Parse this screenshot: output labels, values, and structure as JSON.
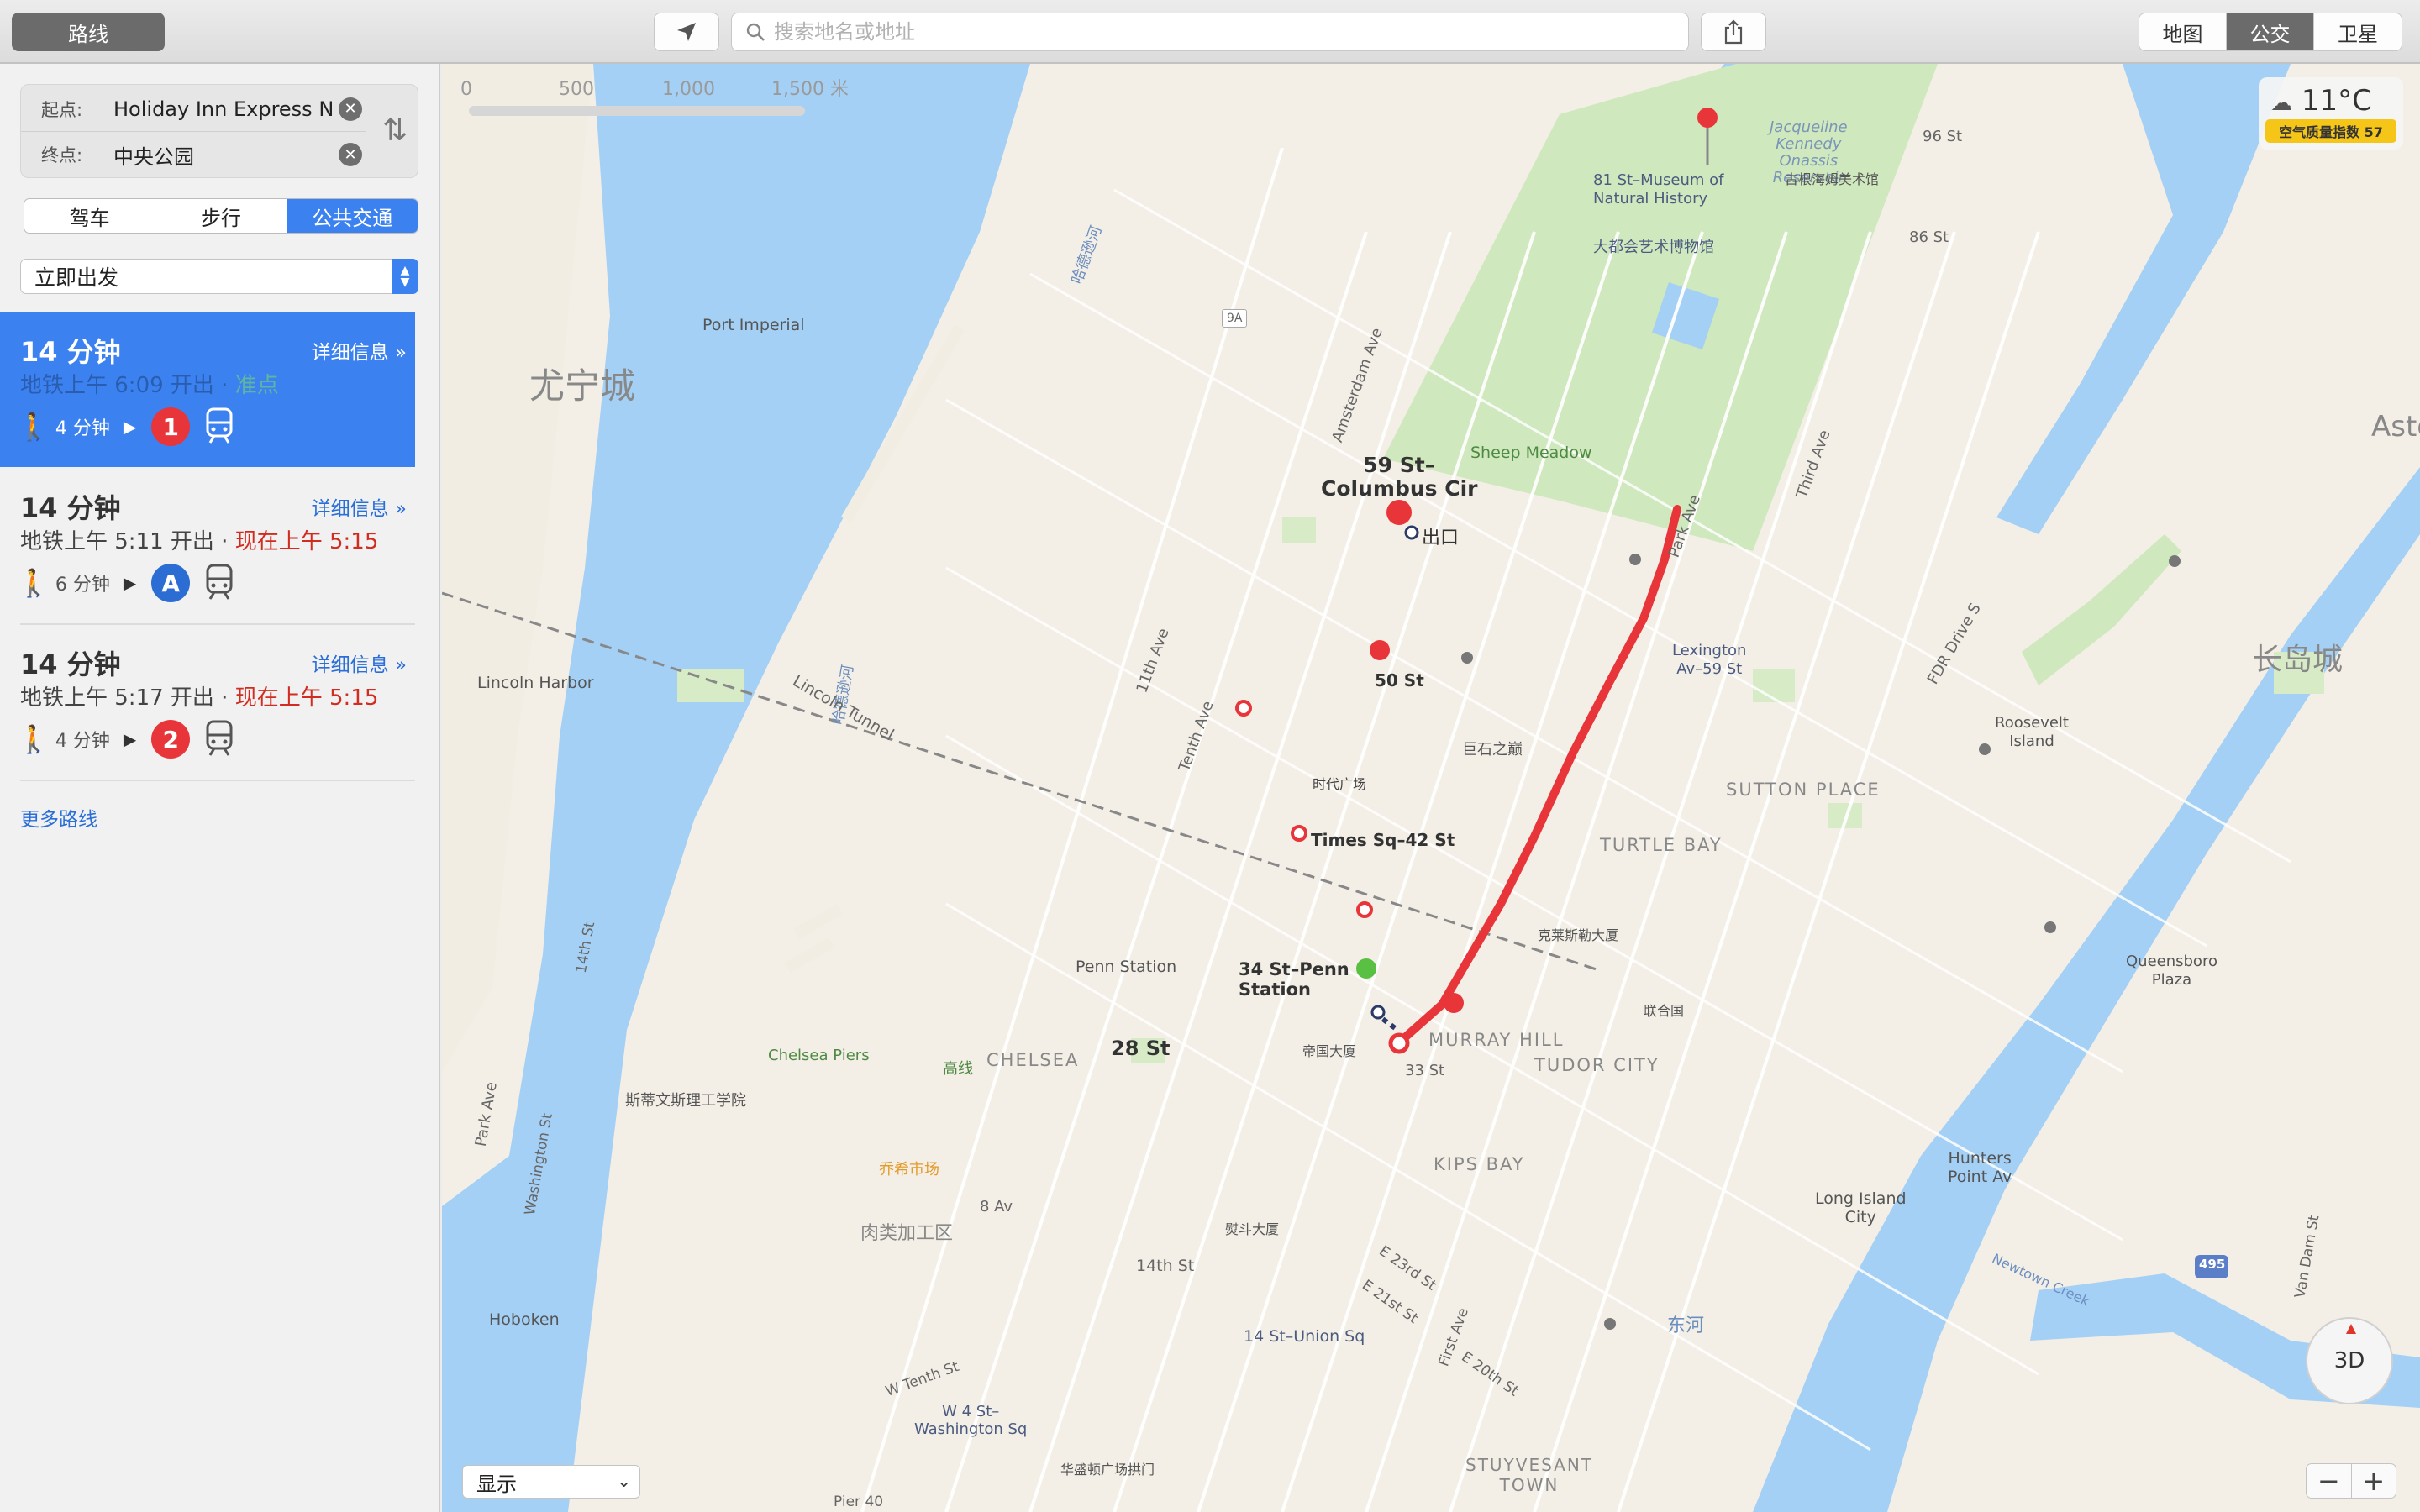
{
  "toolbar": {
    "routes_label": "路线",
    "search_placeholder": "搜索地名或地址",
    "map_types": [
      "地图",
      "公交",
      "卫星"
    ],
    "active_map_type": "公交"
  },
  "sidebar": {
    "start_label": "起点:",
    "start_value": "Holiday Inn Express N",
    "end_label": "终点:",
    "end_value": "中央公园",
    "modes": [
      "驾车",
      "步行",
      "公共交通"
    ],
    "active_mode": "公共交通",
    "depart": "立即出发",
    "routes": [
      {
        "duration": "14 分钟",
        "detail": "详细信息 »",
        "depart": "地铁上午 6:09 开出 · ",
        "status": "准点",
        "walk": "4 分钟",
        "line": "1",
        "line_color": "#e8353a"
      },
      {
        "duration": "14 分钟",
        "detail": "详细信息 »",
        "depart": "地铁上午 5:11 开出 · ",
        "status": "现在上午 5:15",
        "walk": "6 分钟",
        "line": "A",
        "line_color": "#2c6dd3"
      },
      {
        "duration": "14 分钟",
        "detail": "详细信息 »",
        "depart": "地铁上午 5:17 开出 · ",
        "status": "现在上午 5:15",
        "walk": "4 分钟",
        "line": "2",
        "line_color": "#e8353a"
      }
    ],
    "more_routes": "更多路线"
  },
  "map": {
    "scale_labels": [
      "0",
      "500",
      "1,000",
      "1,500 米"
    ],
    "weather": {
      "temp": "11°C",
      "aqi": "空气质量指数 57"
    },
    "compass_label": "3D",
    "show_select": "显示",
    "zoom_out": "−",
    "zoom_in": "+",
    "labels": {
      "jackie": "Jacqueline\nKennedy\nOnassis\nReservoir",
      "guggenheim": "古根海姆美术馆",
      "museum_81": "81 St–Museum of\nNatural History",
      "met": "大都会艺术博物馆",
      "st96": "96 St",
      "st86": "86 St",
      "port_imperial": "Port Imperial",
      "hudson1": "哈德逊河",
      "hudson2": "哈德逊河",
      "union_city": "尤宁城",
      "amsterdam": "Amsterdam Ave",
      "sheep": "Sheep Meadow",
      "third": "Third Ave",
      "park_ave": "Park Ave",
      "astoria": "Astoria",
      "columbus": "59 St–\nColumbus Cir",
      "exit": "出口",
      "lexington": "Lexington\nAv–59 St",
      "fdr": "FDR Drive S",
      "st50": "50 St",
      "lincoln_tunnel": "Lincoln Tunnel",
      "lincoln_harbor": "Lincoln Harbor",
      "eleventh": "11th Ave",
      "tenth": "Tenth Ave",
      "times_square": "时代广场",
      "rock": "巨石之巅",
      "roosevelt": "Roosevelt\nIsland",
      "lic_city": "长岛城",
      "sutton": "SUTTON PLACE",
      "turtle": "TURTLE BAY",
      "times42": "Times Sq–42 St",
      "chrysler": "克莱斯勒大厦",
      "un": "联合国",
      "queensboro": "Queensboro\nPlaza",
      "penn_station": "Penn Station",
      "penn34": "34 St–Penn\nStation",
      "st28": "28 St",
      "empire": "帝国大厦",
      "murray": "MURRAY HILL",
      "tudor": "TUDOR CITY",
      "st33": "33 St",
      "chelsea_piers": "Chelsea Piers",
      "highline": "高线",
      "chelsea": "CHELSEA",
      "stevens": "斯蒂文斯理工学院",
      "park_ave_nj": "Park Ave",
      "washington": "Washington St",
      "st14_nj": "14th St",
      "chelsea_market": "乔希市场",
      "av8": "8 Av",
      "meatpacking": "肉类加工区",
      "kips": "KIPS BAY",
      "hunters": "Hunters\nPoint Av",
      "lic": "Long Island\nCity",
      "flatiron": "熨斗大厦",
      "st14": "14th St",
      "e23": "E 23rd St",
      "e21": "E 21st St",
      "east_river": "东河",
      "newtown": "Newtown Creek",
      "first_ave": "First Ave",
      "e20": "E 20th St",
      "vandam": "Van Dam St",
      "union_sq": "14 St–Union Sq",
      "hoboken": "Hoboken",
      "w_tenth": "W Tenth St",
      "w4": "W 4 St–\nWashington Sq",
      "wash_arch": "华盛顿广场拱门",
      "stuy": "STUYVESANT\nTOWN",
      "pier40": "Pier 40",
      "i495": "495",
      "r9a": "9A"
    }
  }
}
